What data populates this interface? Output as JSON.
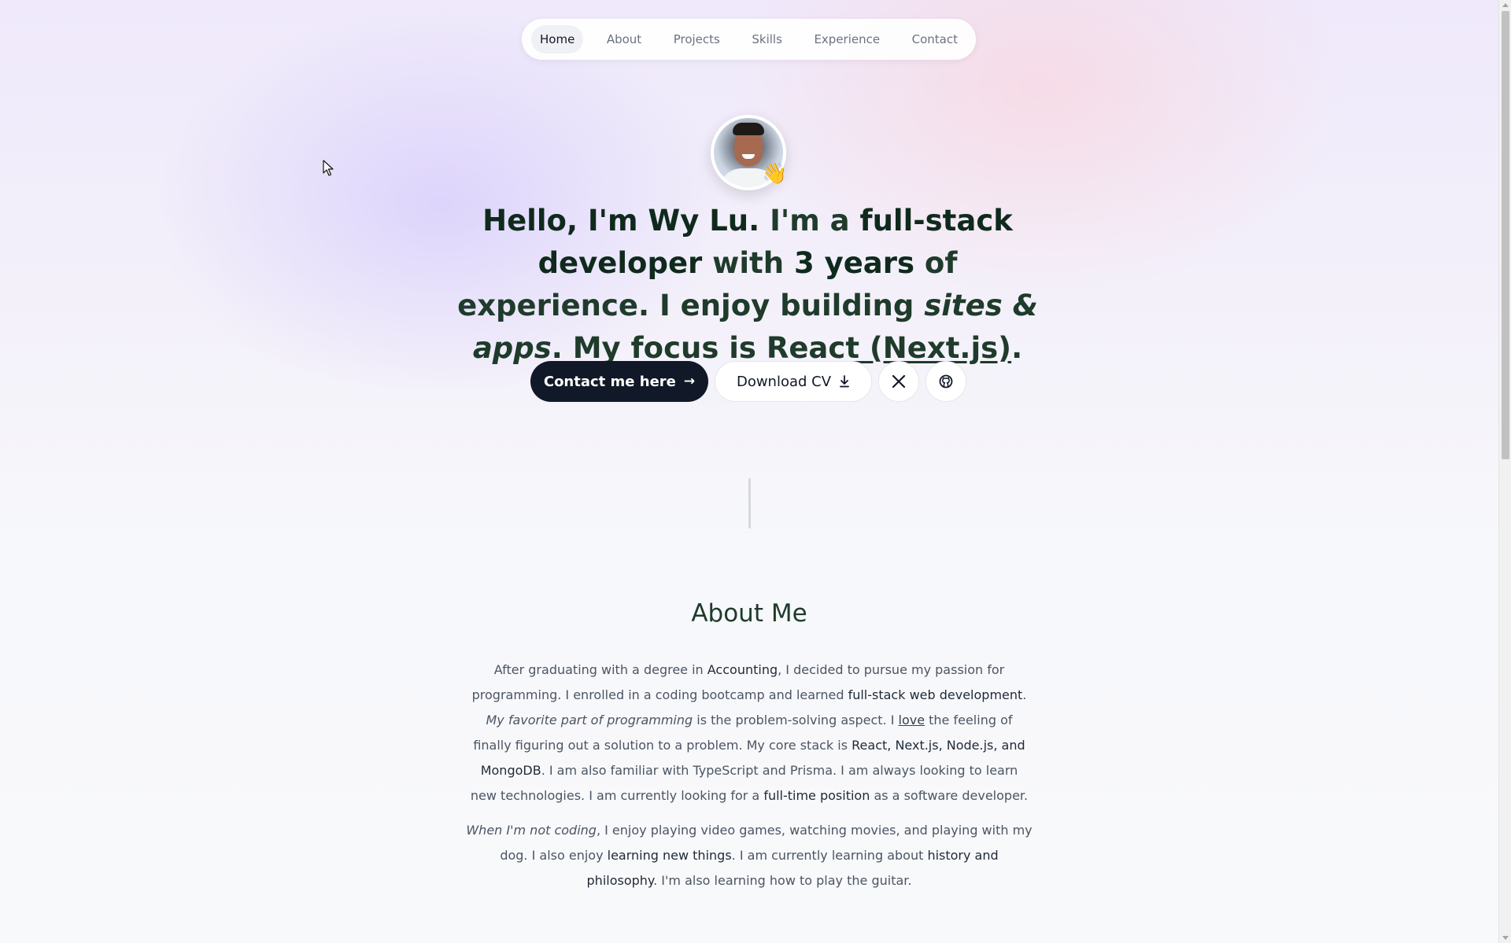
{
  "nav": {
    "items": [
      "Home",
      "About",
      "Projects",
      "Skills",
      "Experience",
      "Contact"
    ],
    "active": "Home"
  },
  "hero": {
    "wave_emoji": "👋",
    "headline": {
      "p1": "Hello, I'm Wy Lu.",
      "p2": " I'm a ",
      "p3": "full-stack developer",
      "p4": " with ",
      "p5": "3 years",
      "p6": " of experience. I enjoy building ",
      "p7": "sites & apps",
      "p8": ". My focus is ",
      "p9": "React (Next.js)",
      "p10": "."
    },
    "buttons": {
      "contact": "Contact me here",
      "contact_icon": "→",
      "download": "Download CV",
      "x_icon_name": "x-logo-icon",
      "github_icon_name": "github-icon"
    }
  },
  "about": {
    "title": "About Me",
    "para1": {
      "a": "After graduating with a degree in ",
      "b": "Accounting",
      "c": ", I decided to pursue my passion for programming. I enrolled in a coding bootcamp and learned ",
      "d": "full-stack web development",
      "e": ". ",
      "f": "My favorite part of programming",
      "g": " is the problem-solving aspect. I ",
      "h": "love",
      "i": " the feeling of finally figuring out a solution to a problem. My core stack is ",
      "j": "React, Next.js, Node.js, and MongoDB",
      "k": ". I am also familiar with TypeScript and Prisma. I am always looking to learn new technologies. I am currently looking for a ",
      "l": "full-time position",
      "m": " as a software developer."
    },
    "para2": {
      "a": "When I'm not coding",
      "b": ", I enjoy playing video games, watching movies, and playing with my dog. I also enjoy ",
      "c": "learning new things",
      "d": ". I am currently learning about ",
      "e": "history and philosophy",
      "f": ". I'm also learning how to play the guitar."
    }
  },
  "colors": {
    "primary_button": "#111827",
    "heading_text": "#1f3b2b",
    "body_text": "#4b5563"
  }
}
